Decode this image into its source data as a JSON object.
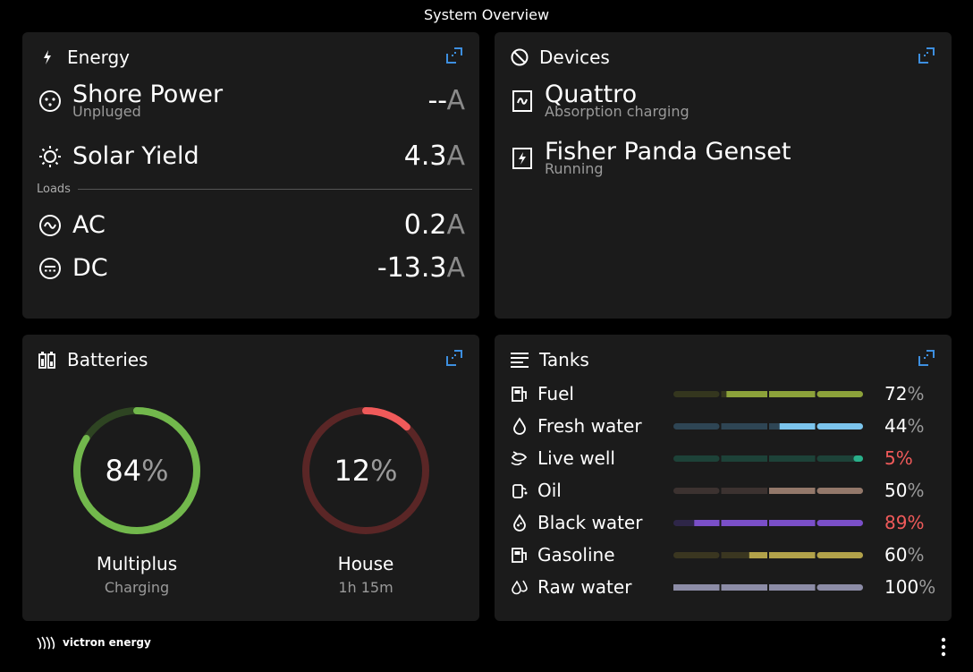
{
  "title": "System Overview",
  "energy": {
    "title": "Energy",
    "shore": {
      "name": "Shore Power",
      "status": "Unpluged",
      "value": "--",
      "unit": "A"
    },
    "solar": {
      "name": "Solar Yield",
      "value": "4.3",
      "unit": "A"
    },
    "loads_label": "Loads",
    "ac": {
      "name": "AC",
      "value": "0.2",
      "unit": "A"
    },
    "dc": {
      "name": "DC",
      "value": "-13.3",
      "unit": "A"
    }
  },
  "devices": {
    "title": "Devices",
    "items": [
      {
        "name": "Quattro",
        "status": "Absorption charging"
      },
      {
        "name": "Fisher Panda Genset",
        "status": "Running"
      }
    ]
  },
  "batteries": {
    "title": "Batteries",
    "items": [
      {
        "name": "Multiplus",
        "status": "Charging",
        "value": "84",
        "unit": "%",
        "level": 84,
        "color": "#72b84c",
        "track": "#2e4422"
      },
      {
        "name": "House",
        "status": "1h 15m",
        "value": "12",
        "unit": "%",
        "level": 12,
        "color": "#f05a5a",
        "track": "#5a2626"
      }
    ]
  },
  "tanks": {
    "title": "Tanks",
    "items": [
      {
        "name": "Fuel",
        "icon": "fuel-icon",
        "value": "72",
        "unit": "%",
        "level": 72,
        "color": "#8ca23a",
        "track": "#34361e",
        "alert": false
      },
      {
        "name": "Fresh water",
        "icon": "droplet-icon",
        "value": "44",
        "unit": "%",
        "level": 44,
        "color": "#7bc4ec",
        "track": "#2e4554",
        "alert": false
      },
      {
        "name": "Live well",
        "icon": "fish-icon",
        "value": "5",
        "unit": "%",
        "level": 5,
        "color": "#29b08a",
        "track": "#1d4238",
        "alert": true
      },
      {
        "name": "Oil",
        "icon": "oil-icon",
        "value": "50",
        "unit": "%",
        "level": 50,
        "color": "#93786a",
        "track": "#3c3230",
        "alert": false
      },
      {
        "name": "Black water",
        "icon": "black-water-icon",
        "value": "89",
        "unit": "%",
        "level": 89,
        "color": "#7a4fc8",
        "track": "#2e2648",
        "alert": true
      },
      {
        "name": "Gasoline",
        "icon": "gasoline-icon",
        "value": "60",
        "unit": "%",
        "level": 60,
        "color": "#b2a24a",
        "track": "#3a3620",
        "alert": false
      },
      {
        "name": "Raw water",
        "icon": "raw-water-icon",
        "value": "100",
        "unit": "%",
        "level": 100,
        "color": "#8c8ca6",
        "track": "#3a3a46",
        "alert": false
      }
    ]
  },
  "colors": {
    "accent": "#3d8fe0",
    "alert": "#f05a5a"
  },
  "brand": "victron energy"
}
